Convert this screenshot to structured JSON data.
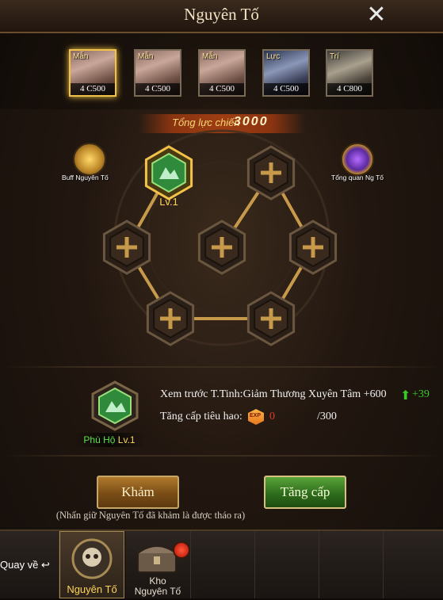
{
  "window": {
    "title": "Nguyên Tố",
    "close_icon": "close-icon"
  },
  "cards": [
    {
      "tag": "Mẫn",
      "label": "4 C500",
      "selected": true
    },
    {
      "tag": "Mẫn",
      "label": "4 C500",
      "selected": false
    },
    {
      "tag": "Mẫn",
      "label": "4 C500",
      "selected": false
    },
    {
      "tag": "Lực",
      "label": "4 C500",
      "selected": false
    },
    {
      "tag": "Trí",
      "label": "4 C800",
      "selected": false
    }
  ],
  "power": {
    "label": "Tổng lực chiến",
    "value": "3000"
  },
  "side": {
    "buff_label": "Buff Nguyên Tố",
    "overview_label": "Tổng quan Ng Tố"
  },
  "board": {
    "slot_level": "Lv.1"
  },
  "info": {
    "preview_label": "Xem trước T.Tinh:",
    "preview_value": "Giảm Thương Xuyên Tâm +600",
    "preview_delta": "+39",
    "cost_label": "Tăng cấp tiêu hao:",
    "cost_value": "0",
    "cost_max": "/300",
    "exp_icon": "EXP"
  },
  "guardian": {
    "name": "Phù Hộ",
    "level": "Lv.1"
  },
  "buttons": {
    "inlay": "Khảm",
    "upgrade": "Tăng cấp"
  },
  "hint": "(Nhấn giữ Nguyên Tố đã khảm là được tháo ra)",
  "nav": {
    "back": "Quay về",
    "element": "Nguyên Tố",
    "storage_line1": "Kho",
    "storage_line2": "Nguyên Tố"
  },
  "colors": {
    "accent_gold": "#f2c24a",
    "upgrade_green": "#2f6c1c",
    "highlight_green": "#56e24a"
  }
}
